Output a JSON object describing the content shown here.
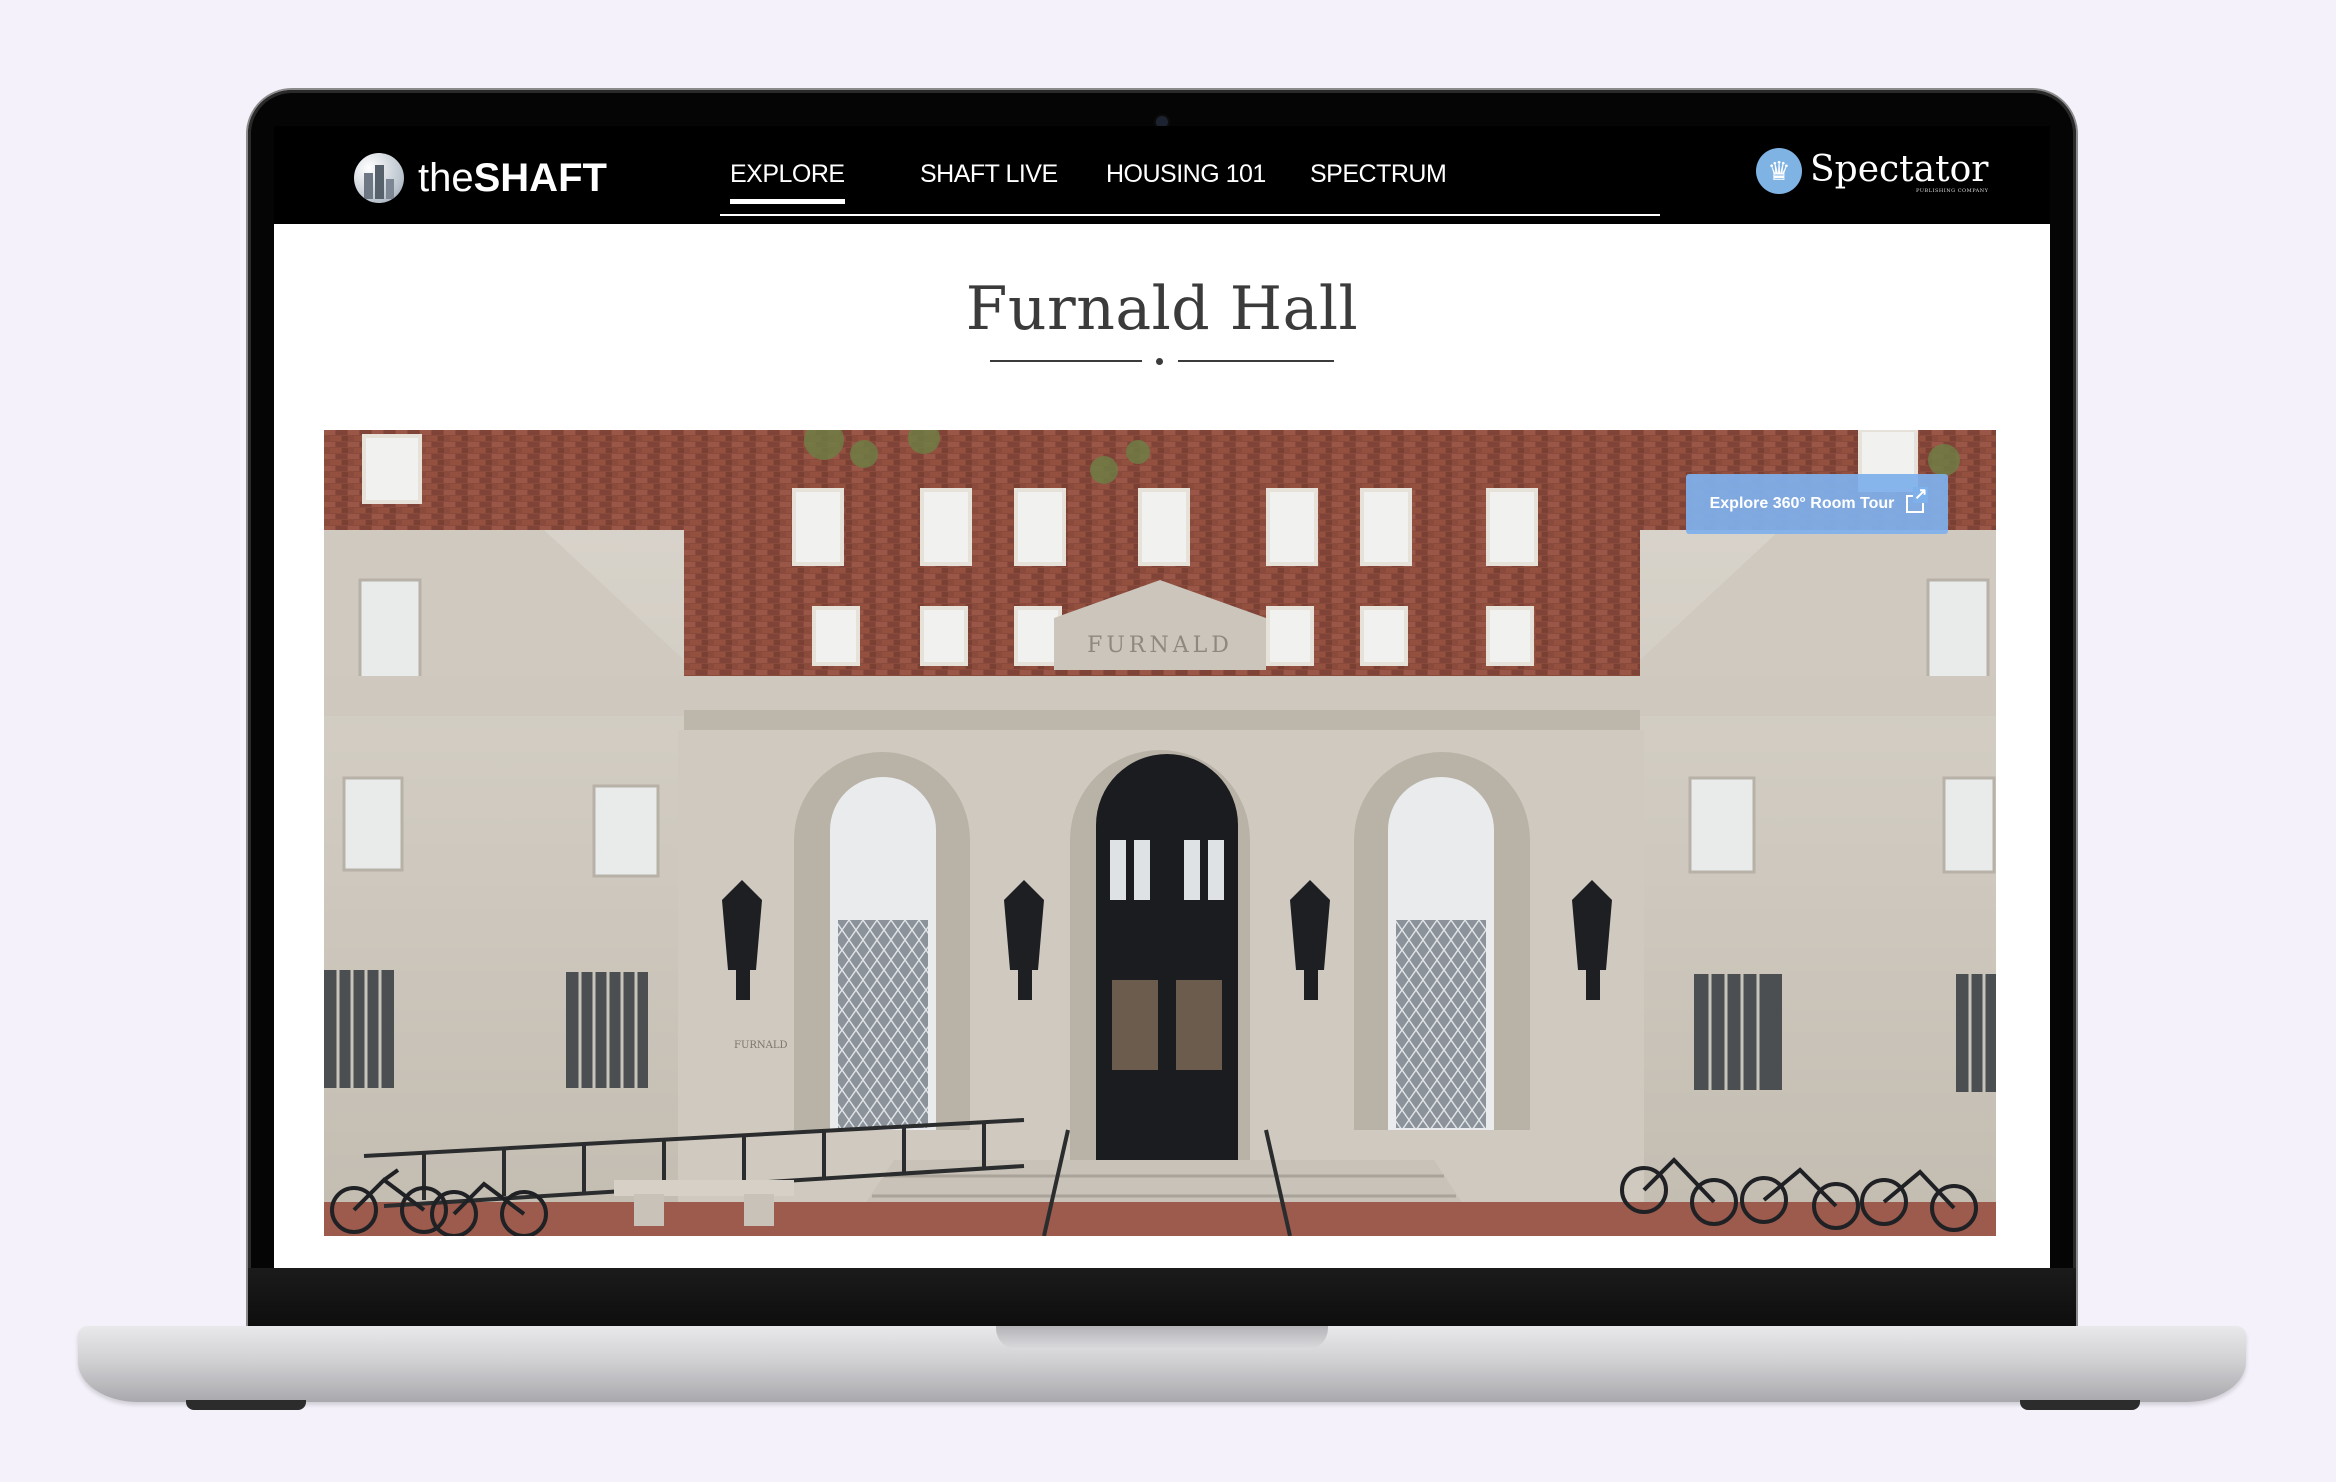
{
  "brand": {
    "logo_prefix": "the",
    "logo_bold": "SHAFT"
  },
  "nav": {
    "items": [
      {
        "label": "EXPLORE",
        "active": true
      },
      {
        "label": "SHAFT LIVE",
        "active": false
      },
      {
        "label": "HOUSING 101",
        "active": false
      },
      {
        "label": "SPECTRUM",
        "active": false
      }
    ]
  },
  "partner": {
    "name": "Spectator",
    "subtitle": "PUBLISHING COMPANY",
    "icon": "crown-icon"
  },
  "page": {
    "title": "Furnald Hall"
  },
  "hero": {
    "inscription": "FURNALD",
    "side_plaque": "FURNALD",
    "tour_button": {
      "label": "Explore 360° Room Tour",
      "icon": "external-link-icon"
    }
  },
  "colors": {
    "accent_blue": "#7eb0ec",
    "nav_bg": "#000000",
    "title": "#3b3b3b"
  }
}
